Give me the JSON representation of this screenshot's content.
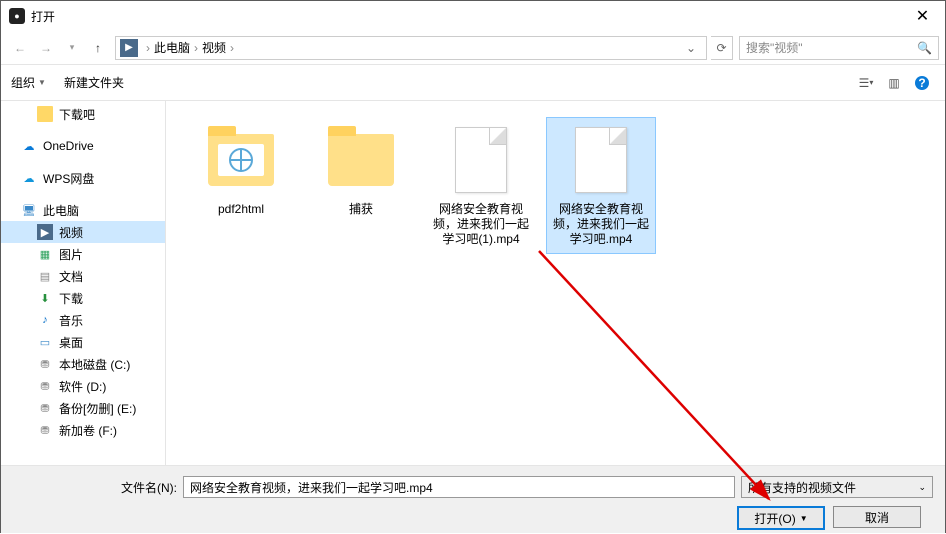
{
  "window": {
    "title": "打开"
  },
  "nav": {
    "breadcrumb": {
      "root": "此电脑",
      "folder": "视频"
    },
    "search_placeholder": "搜索\"视频\""
  },
  "toolbar": {
    "organize": "组织",
    "newfolder": "新建文件夹"
  },
  "sidebar": {
    "items": [
      {
        "label": "下载吧",
        "icon": "folder-y",
        "indent": true
      },
      {
        "label": "OneDrive",
        "icon": "cloud-b"
      },
      {
        "label": "WPS网盘",
        "icon": "cloud-o"
      },
      {
        "label": "此电脑",
        "icon": "pc"
      },
      {
        "label": "视频",
        "icon": "vid",
        "indent": true,
        "selected": true
      },
      {
        "label": "图片",
        "icon": "img",
        "indent": true
      },
      {
        "label": "文档",
        "icon": "doc",
        "indent": true
      },
      {
        "label": "下载",
        "icon": "dl",
        "indent": true
      },
      {
        "label": "音乐",
        "icon": "music",
        "indent": true
      },
      {
        "label": "桌面",
        "icon": "desk",
        "indent": true
      },
      {
        "label": "本地磁盘 (C:)",
        "icon": "disk",
        "indent": true
      },
      {
        "label": "软件 (D:)",
        "icon": "disk",
        "indent": true
      },
      {
        "label": "备份[勿删] (E:)",
        "icon": "disk",
        "indent": true
      },
      {
        "label": "新加卷 (F:)",
        "icon": "disk",
        "indent": true
      }
    ]
  },
  "files": [
    {
      "name": "pdf2html",
      "type": "folder-globe"
    },
    {
      "name": "捕获",
      "type": "folder"
    },
    {
      "name": "网络安全教育视频，进来我们一起学习吧(1).mp4",
      "type": "file"
    },
    {
      "name": "网络安全教育视频，进来我们一起学习吧.mp4",
      "type": "file",
      "selected": true
    }
  ],
  "bottom": {
    "filename_label": "文件名(N):",
    "filename_value": "网络安全教育视频，进来我们一起学习吧.mp4",
    "filter": "所有支持的视频文件",
    "open": "打开(O)",
    "cancel": "取消"
  }
}
